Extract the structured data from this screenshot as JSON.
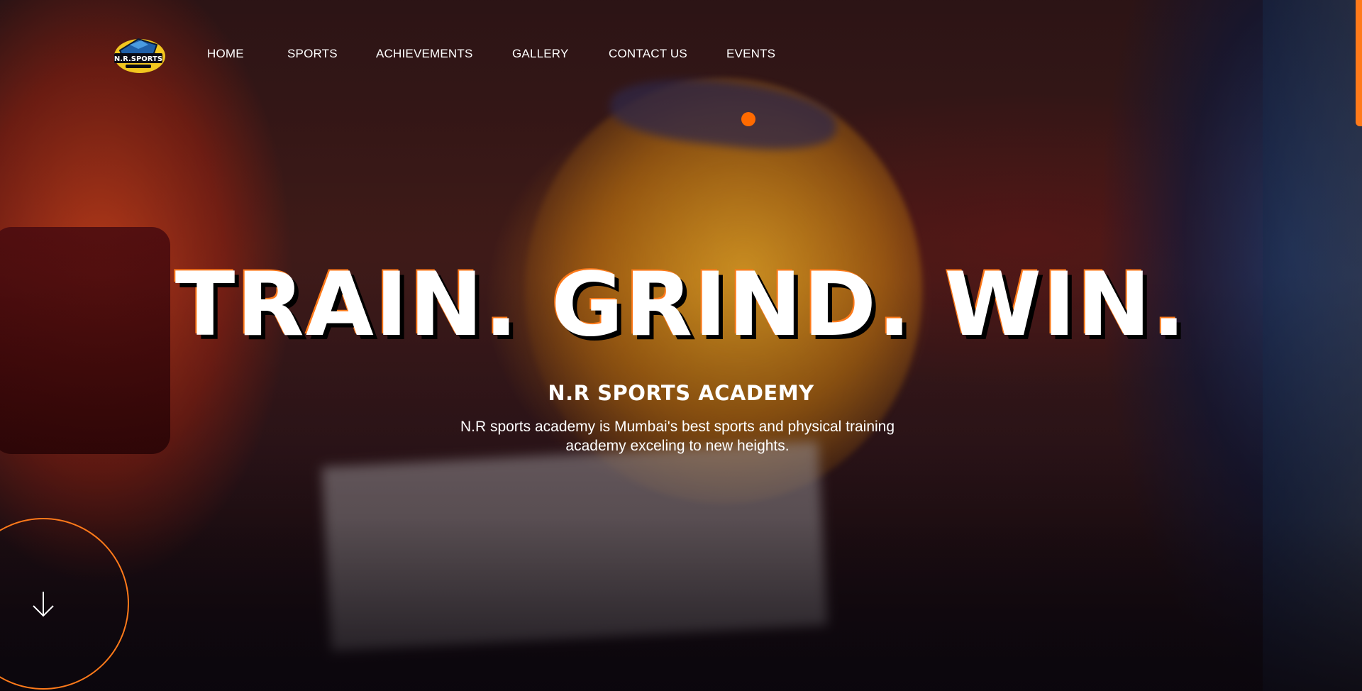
{
  "brand": {
    "logo_text": "N.R.SPORTS",
    "accent_color": "#ff6a00"
  },
  "nav": {
    "items": [
      {
        "label": "HOME"
      },
      {
        "label": "SPORTS"
      },
      {
        "label": "ACHIEVEMENTS"
      },
      {
        "label": "GALLERY"
      },
      {
        "label": "CONTACT US"
      },
      {
        "label": "EVENTS"
      }
    ],
    "active_indicator": "orange-dot"
  },
  "hero": {
    "headline": "TRAIN. GRIND. WIN.",
    "subtitle": "N.R SPORTS ACADEMY",
    "description": "N.R sports academy is Mumbai's best sports and physical training academy exceling to new heights."
  },
  "scroll_button": {
    "icon": "arrow-down-icon"
  }
}
